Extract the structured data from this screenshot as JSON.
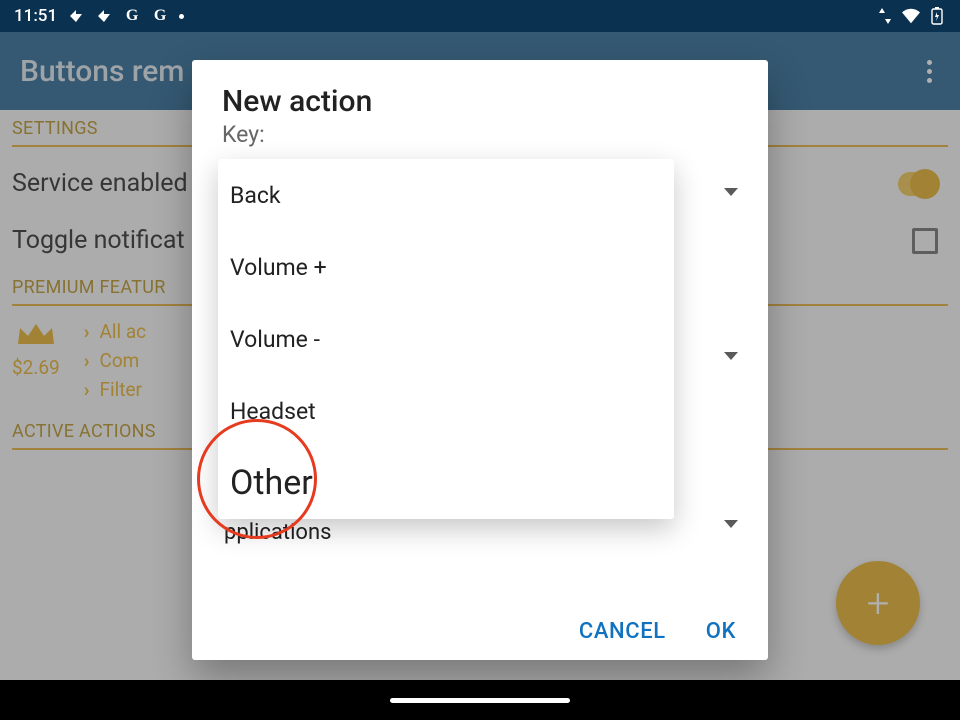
{
  "statusbar": {
    "time": "11:51",
    "icons_left": [
      "arrow1",
      "arrow2",
      "G",
      "G",
      "dot"
    ],
    "icons_right": [
      "updown",
      "wifi",
      "battery"
    ]
  },
  "appbar": {
    "title": "Buttons rem"
  },
  "background": {
    "sections": {
      "settings_label": "SETTINGS",
      "service_enabled_label": "Service enabled",
      "toggle_notification_label": "Toggle notificat",
      "premium_label": "PREMIUM FEATUR",
      "active_actions_label": "ACTIVE ACTIONS"
    },
    "premium": {
      "price": "$2.69",
      "features": [
        "All ac",
        "Com",
        "Filter"
      ]
    }
  },
  "dialog": {
    "title": "New action",
    "key_label": "Key:",
    "key_value": "Back",
    "dropdowns_hidden_value": "pplications",
    "cancel": "CANCEL",
    "ok": "OK"
  },
  "popup": {
    "options": [
      "Back",
      "Volume +",
      "Volume -",
      "Headset",
      "Other"
    ]
  },
  "colors": {
    "accent_amber": "#e6ac20",
    "accent_blue": "#1172c0",
    "statusbar_bg": "#0b3150",
    "appbar_bg": "#1f6291",
    "highlight_red": "#e63b1e"
  }
}
